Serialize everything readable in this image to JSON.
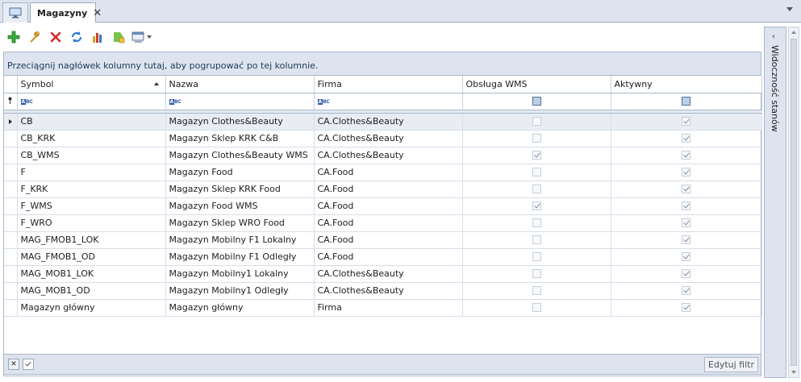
{
  "tabs": {
    "active_label": "Magazyny",
    "close_glyph": "✕"
  },
  "toolbar": {
    "icons": [
      "add-icon",
      "edit-icon",
      "delete-icon",
      "refresh-icon",
      "chart-icon",
      "run-icon",
      "view-icon"
    ]
  },
  "grid": {
    "group_hint": "Przeciągnij nagłówek kolumny tutaj, aby pogrupować po tej kolumnie.",
    "columns": [
      "Symbol",
      "Nazwa",
      "Firma",
      "Obsługa WMS",
      "Aktywny"
    ],
    "filter_abc": "ABC",
    "rows": [
      {
        "symbol": "CB",
        "nazwa": "Magazyn Clothes&Beauty",
        "firma": "CA.Clothes&Beauty",
        "wms": false,
        "aktywny": true
      },
      {
        "symbol": "CB_KRK",
        "nazwa": "Magazyn Sklep KRK C&B",
        "firma": "CA.Clothes&Beauty",
        "wms": false,
        "aktywny": true
      },
      {
        "symbol": "CB_WMS",
        "nazwa": "Magazyn Clothes&Beauty WMS",
        "firma": "CA.Clothes&Beauty",
        "wms": true,
        "aktywny": true
      },
      {
        "symbol": "F",
        "nazwa": "Magazyn Food",
        "firma": "CA.Food",
        "wms": false,
        "aktywny": true
      },
      {
        "symbol": "F_KRK",
        "nazwa": "Magazyn Sklep KRK Food",
        "firma": "CA.Food",
        "wms": false,
        "aktywny": true
      },
      {
        "symbol": "F_WMS",
        "nazwa": "Magazyn Food WMS",
        "firma": "CA.Food",
        "wms": true,
        "aktywny": true
      },
      {
        "symbol": "F_WRO",
        "nazwa": "Magazyn Sklep WRO Food",
        "firma": "CA.Food",
        "wms": false,
        "aktywny": true
      },
      {
        "symbol": "MAG_FMOB1_LOK",
        "nazwa": "Magazyn Mobilny F1 Lokalny",
        "firma": "CA.Food",
        "wms": false,
        "aktywny": true
      },
      {
        "symbol": "MAG_FMOB1_OD",
        "nazwa": "Magazyn Mobilny F1 Odległy",
        "firma": "CA.Food",
        "wms": false,
        "aktywny": true
      },
      {
        "symbol": "MAG_MOB1_LOK",
        "nazwa": "Magazyn Mobilny1 Lokalny",
        "firma": "CA.Clothes&Beauty",
        "wms": false,
        "aktywny": true
      },
      {
        "symbol": "MAG_MOB1_OD",
        "nazwa": "Magazyn Mobilny1 Odległy",
        "firma": "CA.Clothes&Beauty",
        "wms": false,
        "aktywny": true
      },
      {
        "symbol": "Magazyn główny",
        "nazwa": "Magazyn główny",
        "firma": "Firma",
        "wms": false,
        "aktywny": true
      }
    ]
  },
  "footer": {
    "clear_glyph": "✕",
    "edit_filter_label": "Edytuj filtr"
  },
  "side_panel": {
    "title": "Widoczność stanów",
    "collapse_glyph": "‹"
  }
}
